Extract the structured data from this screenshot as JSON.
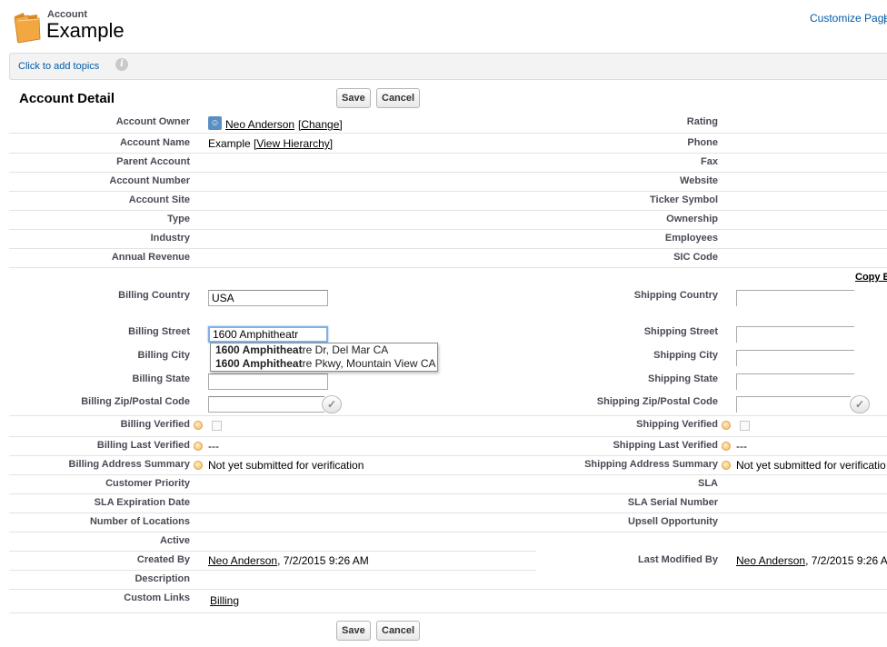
{
  "header": {
    "object_type": "Account",
    "record_name": "Example",
    "customize_link": "Customize Page",
    "separator": "|"
  },
  "topics": {
    "label": "Click to add topics"
  },
  "section": {
    "title": "Account Detail"
  },
  "buttons": {
    "save": "Save",
    "cancel": "Cancel"
  },
  "left_fields": {
    "account_owner": {
      "label": "Account Owner",
      "value": "Neo Anderson",
      "change": "[Change]"
    },
    "account_name": {
      "label": "Account Name",
      "value": "Example",
      "hierarchy": "[View Hierarchy]"
    },
    "parent_account": {
      "label": "Parent Account"
    },
    "account_number": {
      "label": "Account Number"
    },
    "account_site": {
      "label": "Account Site"
    },
    "type": {
      "label": "Type"
    },
    "industry": {
      "label": "Industry"
    },
    "annual_revenue": {
      "label": "Annual Revenue"
    }
  },
  "right_fields": {
    "rating": {
      "label": "Rating"
    },
    "phone": {
      "label": "Phone"
    },
    "fax": {
      "label": "Fax"
    },
    "website": {
      "label": "Website"
    },
    "ticker_symbol": {
      "label": "Ticker Symbol"
    },
    "ownership": {
      "label": "Ownership"
    },
    "employees": {
      "label": "Employees"
    },
    "sic_code": {
      "label": "SIC Code"
    }
  },
  "copy_link": "Copy B",
  "billing": {
    "country": {
      "label": "Billing Country",
      "value": "USA"
    },
    "street": {
      "label": "Billing Street",
      "value": "1600 Amphitheatr"
    },
    "city": {
      "label": "Billing City"
    },
    "state": {
      "label": "Billing State"
    },
    "zip": {
      "label": "Billing Zip/Postal Code"
    },
    "verified": {
      "label": "Billing Verified"
    },
    "last_verified": {
      "label": "Billing Last Verified",
      "value": "---"
    },
    "summary": {
      "label": "Billing Address Summary",
      "value": "Not yet submitted for verification"
    }
  },
  "shipping": {
    "country": {
      "label": "Shipping Country"
    },
    "street": {
      "label": "Shipping Street"
    },
    "city": {
      "label": "Shipping City"
    },
    "state": {
      "label": "Shipping State"
    },
    "zip": {
      "label": "Shipping Zip/Postal Code"
    },
    "verified": {
      "label": "Shipping Verified"
    },
    "last_verified": {
      "label": "Shipping Last Verified",
      "value": "---"
    },
    "summary": {
      "label": "Shipping Address Summary",
      "value": "Not yet submitted for verificatio"
    }
  },
  "autocomplete": {
    "items": [
      {
        "match": "1600 Amphitheat",
        "rest": "re Dr, Del Mar CA"
      },
      {
        "match": "1600 Amphitheat",
        "rest": "re Pkwy, Mountain View CA"
      }
    ]
  },
  "lower_left": {
    "customer_priority": {
      "label": "Customer Priority"
    },
    "sla_expiration": {
      "label": "SLA Expiration Date"
    },
    "locations": {
      "label": "Number of Locations"
    },
    "active": {
      "label": "Active"
    },
    "created_by": {
      "label": "Created By",
      "user": "Neo Anderson",
      "date": ", 7/2/2015 9:26 AM"
    },
    "description": {
      "label": "Description"
    },
    "custom_links": {
      "label": "Custom Links",
      "link": "Billing"
    }
  },
  "lower_right": {
    "sla": {
      "label": "SLA"
    },
    "sla_serial": {
      "label": "SLA Serial Number"
    },
    "upsell": {
      "label": "Upsell Opportunity"
    },
    "last_modified": {
      "label": "Last Modified By",
      "user": "Neo Anderson",
      "date": ", 7/2/2015 9:26 A"
    }
  },
  "icons": {
    "folder": "folder-icon",
    "info": "info-icon",
    "user": "user-icon",
    "verify": "checkmark-icon"
  }
}
